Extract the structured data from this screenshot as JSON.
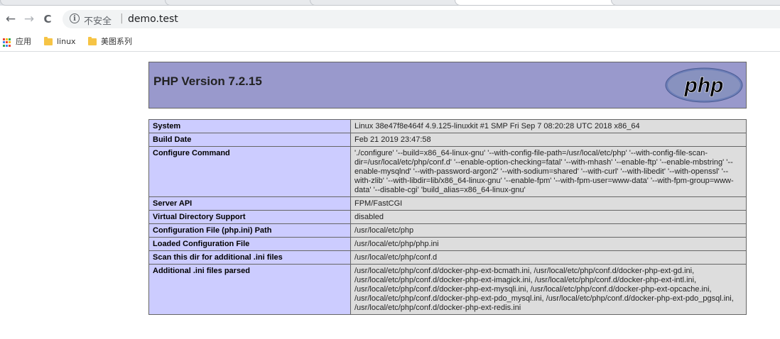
{
  "browser": {
    "security_label": "不安全",
    "url": "demo.test",
    "nav": {
      "back": "←",
      "forward": "→",
      "reload": "C",
      "info": "i"
    }
  },
  "bookmarks": [
    {
      "label": "应用",
      "icon": "apps-icon"
    },
    {
      "label": "linux",
      "icon": "folder-icon"
    },
    {
      "label": "美图系列",
      "icon": "folder-icon"
    }
  ],
  "page": {
    "title": "PHP Version 7.2.15",
    "logo_text": "php",
    "colors": {
      "header_bg": "#9999cc",
      "key_bg": "#ccccff",
      "value_bg": "#dddddd"
    },
    "rows": [
      {
        "key": "System",
        "value": "Linux 38e47f8e464f 4.9.125-linuxkit #1 SMP Fri Sep 7 08:20:28 UTC 2018 x86_64"
      },
      {
        "key": "Build Date",
        "value": "Feb 21 2019 23:47:58"
      },
      {
        "key": "Configure Command",
        "value": "'./configure' '--build=x86_64-linux-gnu' '--with-config-file-path=/usr/local/etc/php' '--with-config-file-scan-dir=/usr/local/etc/php/conf.d' '--enable-option-checking=fatal' '--with-mhash' '--enable-ftp' '--enable-mbstring' '--enable-mysqlnd' '--with-password-argon2' '--with-sodium=shared' '--with-curl' '--with-libedit' '--with-openssl' '--with-zlib' '--with-libdir=lib/x86_64-linux-gnu' '--enable-fpm' '--with-fpm-user=www-data' '--with-fpm-group=www-data' '--disable-cgi' 'build_alias=x86_64-linux-gnu'"
      },
      {
        "key": "Server API",
        "value": "FPM/FastCGI"
      },
      {
        "key": "Virtual Directory Support",
        "value": "disabled"
      },
      {
        "key": "Configuration File (php.ini) Path",
        "value": "/usr/local/etc/php"
      },
      {
        "key": "Loaded Configuration File",
        "value": "/usr/local/etc/php/php.ini"
      },
      {
        "key": "Scan this dir for additional .ini files",
        "value": "/usr/local/etc/php/conf.d"
      },
      {
        "key": "Additional .ini files parsed",
        "value": "/usr/local/etc/php/conf.d/docker-php-ext-bcmath.ini, /usr/local/etc/php/conf.d/docker-php-ext-gd.ini, /usr/local/etc/php/conf.d/docker-php-ext-imagick.ini, /usr/local/etc/php/conf.d/docker-php-ext-intl.ini, /usr/local/etc/php/conf.d/docker-php-ext-mysqli.ini, /usr/local/etc/php/conf.d/docker-php-ext-opcache.ini, /usr/local/etc/php/conf.d/docker-php-ext-pdo_mysql.ini, /usr/local/etc/php/conf.d/docker-php-ext-pdo_pgsql.ini, /usr/local/etc/php/conf.d/docker-php-ext-redis.ini"
      }
    ]
  }
}
